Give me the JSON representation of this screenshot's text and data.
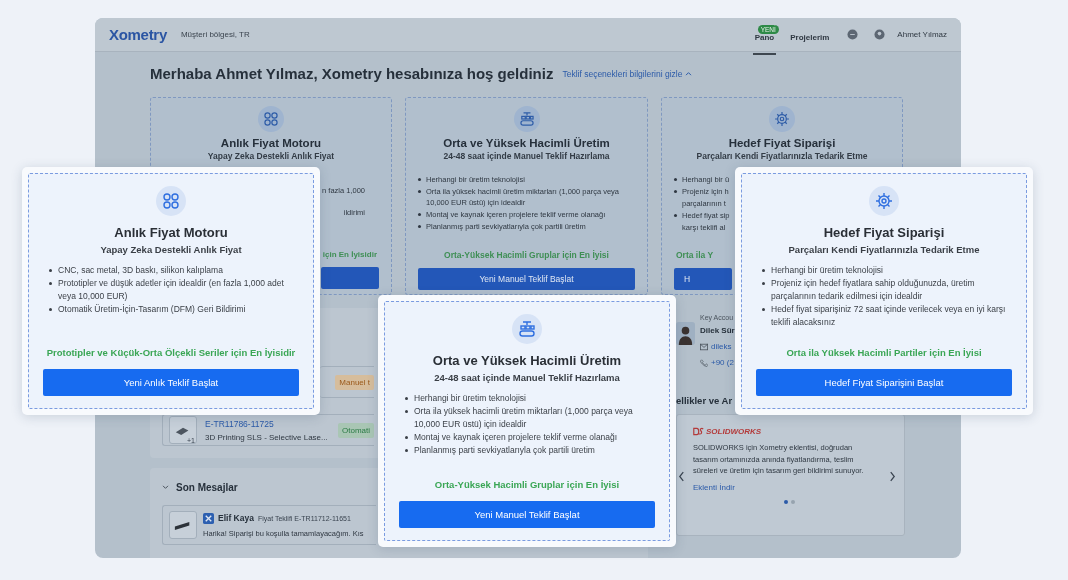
{
  "header": {
    "logo": "Xometry",
    "region": "Müşteri bölgesi, TR",
    "nav": [
      {
        "label": "Pano",
        "badge": "YENİ",
        "selected": true
      },
      {
        "label": "Projelerim",
        "selected": false
      }
    ],
    "user": "Ahmet Yılmaz"
  },
  "greeting": "Merhaba Ahmet Yılmaz, Xometry hesabınıza hoş geldiniz",
  "toggle_link": "Teklif seçenekleri bilgilerini gizle",
  "background_cards": [
    {
      "kind": "instant",
      "title": "Anlık Fiyat Motoru",
      "subtitle": "Yapay Zeka Destekli Anlık Fiyat",
      "lines": [
        {
          "text": "n fazla 1,000"
        },
        {
          "text": "ildirimi"
        }
      ],
      "best_for": "için En İyisidir"
    },
    {
      "kind": "volume",
      "title": "Orta ve Yüksek Hacimli Üretim",
      "subtitle": "24-48 saat içinde Manuel Teklif Hazırlama",
      "lines": [
        {
          "text": "Herhangi bir üretim teknolojisi",
          "bullet": true
        },
        {
          "text": "Orta ila yüksek hacimli üretim miktarları (1,000 parça veya 10,000 EUR üstü) için idealdir",
          "bullet": true
        },
        {
          "text": "Montaj ve kaynak içeren projelere teklif verme olanağı",
          "bullet": true
        },
        {
          "text": "Planlanmış parti sevkiyatlarıyla çok partili üretim",
          "bullet": true
        }
      ],
      "best_for": "Orta-Yüksek Hacimli Gruplar için En İyisi",
      "button": "Yeni Manuel Teklif Başlat"
    },
    {
      "kind": "target",
      "title": "Hedef Fiyat Siparişi",
      "subtitle": "Parçaları Kendi Fiyatlarınızla Tedarik Etme",
      "lines": [
        {
          "text": "Herhangi bir ü",
          "bullet": true
        },
        {
          "text": "Projeniz için h",
          "bullet": true
        },
        {
          "text": "parçalarının t",
          "bullet": false
        },
        {
          "text": "Hedef fiyat sip",
          "bullet": true
        },
        {
          "text": "karşı teklifi al",
          "bullet": false
        }
      ],
      "best_for": "Orta ila Y",
      "button": "H"
    }
  ],
  "projects": {
    "rows": [
      {
        "badge": {
          "kind": "manual",
          "text": "Manuel t"
        }
      },
      {
        "thumb_count": "+1",
        "id": "E-TR11786-11725",
        "description": "3D Printing SLS - Selective Lase...",
        "badge": {
          "kind": "automatic",
          "text": "Otomati"
        }
      }
    ]
  },
  "messages": {
    "title": "Son Mesajlar",
    "items": [
      {
        "sender": "Elif Kaya",
        "subject": "Fiyat Teklifi E-TR11712-11651",
        "text": "Harika! Siparişi bu koşulla tamamlayacağım. Kıs"
      }
    ]
  },
  "account_manager": {
    "label": "Key Accou",
    "name": "Dilek Sür",
    "email": "dileks",
    "phone": "+90 (2"
  },
  "features": {
    "heading": "ellikler ve Ar",
    "plugin": {
      "brand": "SOLIDWORKS",
      "text": "SOLIDWORKS için Xometry eklentisi, doğrudan tasarım ortamınızda anında fiyatlandırma, teslim süreleri ve üretim için tasarım geri bildirimi sunuyor.",
      "link": "Eklenti İndir"
    },
    "dots": [
      {
        "selected": true
      },
      {
        "selected": false
      }
    ]
  },
  "offer_cards": [
    {
      "kind": "instant",
      "title": "Anlık Fiyat Motoru",
      "subtitle": "Yapay Zeka Destekli Anlık Fiyat",
      "bullets": [
        "CNC, sac metal, 3D baskı, silikon kalıplama",
        "Prototipler ve düşük adetler için idealdir (en fazla 1,000 adet veya 10,000 EUR)",
        "Otomatik Üretim-İçin-Tasarım (DFM) Geri Bildirimi"
      ],
      "best_for": "Prototipler ve Küçük-Orta Ölçekli Seriler için En İyisidir",
      "button": "Yeni Anlık Teklif Başlat"
    },
    {
      "kind": "volume",
      "title": "Orta ve Yüksek Hacimli Üretim",
      "subtitle": "24-48 saat içinde Manuel Teklif Hazırlama",
      "bullets": [
        "Herhangi bir üretim teknolojisi",
        "Orta ila yüksek hacimli üretim miktarları (1,000 parça veya 10,000 EUR üstü) için idealdir",
        "Montaj ve kaynak içeren projelere teklif verme olanağı",
        "Planlanmış parti sevkiyatlarıyla çok partili üretim"
      ],
      "best_for": "Orta-Yüksek Hacimli Gruplar için En İyisi",
      "button": "Yeni Manuel Teklif Başlat"
    },
    {
      "kind": "target",
      "title": "Hedef Fiyat Siparişi",
      "subtitle": "Parçaları Kendi Fiyatlarınızla Tedarik Etme",
      "bullets": [
        "Herhangi bir üretim teknolojisi",
        "Projeniz için hedef fiyatlara sahip olduğunuzda, üretim parçalarının tedarik edilmesi için idealdir",
        "Hedef fiyat siparişiniz 72 saat içinde verilecek veya en iyi karşı teklifi alacaksınız"
      ],
      "best_for": "Orta ila Yüksek Hacimli Partiler için En İyisi",
      "button": "Hedef Fiyat Siparişini Başlat"
    }
  ]
}
